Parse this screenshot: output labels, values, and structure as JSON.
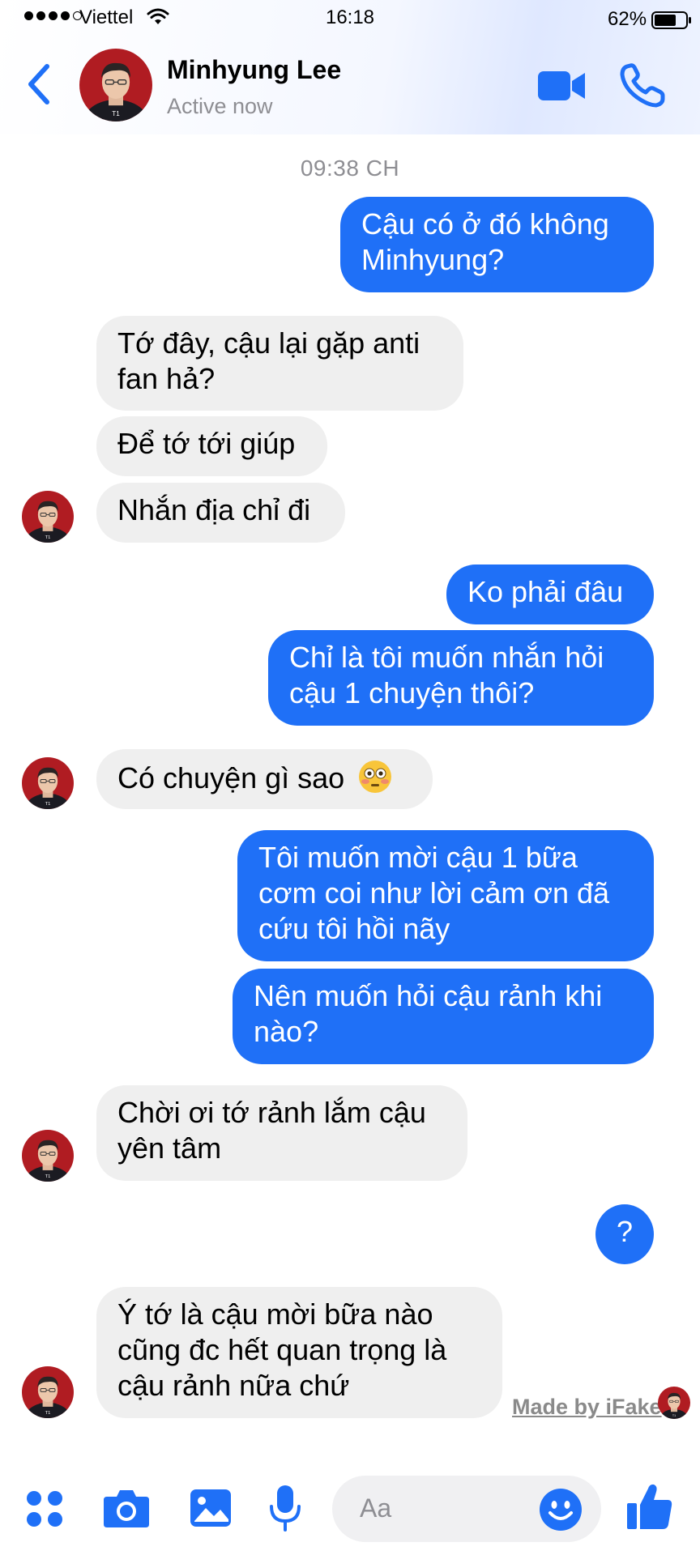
{
  "status_bar": {
    "carrier": "Viettel",
    "time": "16:18",
    "battery": "62%"
  },
  "header": {
    "contact_name": "Minhyung Lee",
    "contact_status": "Active now"
  },
  "conversation": {
    "timestamp": "09:38 CH",
    "messages": [
      {
        "from": "me",
        "text": "Cậu có ở đó không Minhyung?"
      },
      {
        "from": "contact",
        "text": "Tớ đây, cậu lại gặp anti fan hả?"
      },
      {
        "from": "contact",
        "text": "Để tớ tới giúp"
      },
      {
        "from": "contact",
        "text": "Nhắn địa chỉ đi"
      },
      {
        "from": "me",
        "text": "Ko phải đâu"
      },
      {
        "from": "me",
        "text": "Chỉ là tôi muốn nhắn hỏi cậu 1 chuyện thôi?"
      },
      {
        "from": "contact",
        "text": "Có chuyện gì sao",
        "emoji": "flushed-face-emoji"
      },
      {
        "from": "me",
        "text": "Tôi muốn mời cậu 1 bữa cơm coi như lời cảm ơn đã cứu tôi hồi nãy"
      },
      {
        "from": "me",
        "text": "Nên muốn hỏi cậu rảnh khi nào?"
      },
      {
        "from": "contact",
        "text": "Chời ơi tớ rảnh lắm cậu yên tâm"
      },
      {
        "from": "me",
        "text": "?"
      },
      {
        "from": "contact",
        "text": "Ý tớ là cậu mời bữa nào cũng đc hết quan trọng là cậu rảnh nữa chứ"
      }
    ]
  },
  "watermark": "Made by iFake",
  "composer": {
    "placeholder": "Aa"
  },
  "colors": {
    "messenger_blue": "#1f70f7",
    "incoming_bubble": "#efefef",
    "secondary_text": "#8e8e93"
  },
  "icons": [
    "back-icon",
    "video-call-icon",
    "phone-icon",
    "menu-dots-icon",
    "camera-icon",
    "image-icon",
    "microphone-icon",
    "smiley-icon",
    "thumbs-up-icon"
  ]
}
